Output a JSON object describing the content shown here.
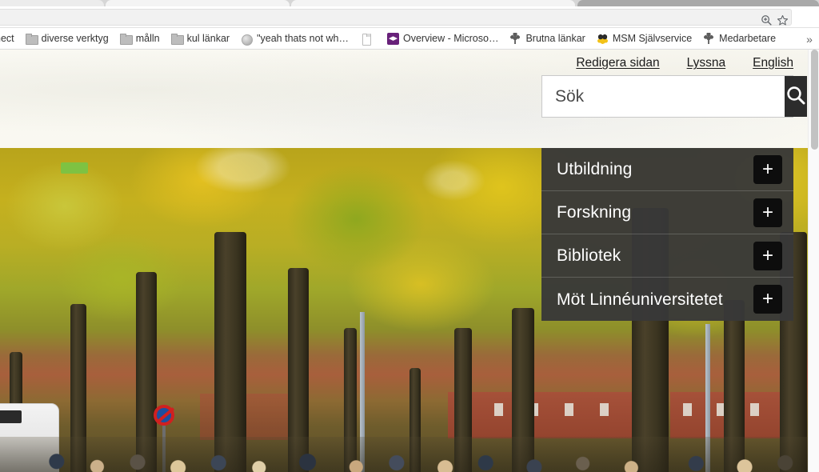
{
  "browser": {
    "toolbar": {
      "zoom_icon": "zoom-in-icon",
      "bookmark_icon": "star-icon",
      "menu_icon": "three-dot-menu-icon"
    },
    "bookmarks": {
      "overflow_label": "»",
      "items": [
        {
          "label": "nect",
          "icon": "partial-bookmark-icon"
        },
        {
          "label": "diverse verktyg",
          "icon": "folder-icon"
        },
        {
          "label": "målln",
          "icon": "folder-icon"
        },
        {
          "label": "kul länkar",
          "icon": "folder-icon"
        },
        {
          "label": "\"yeah thats not wh…",
          "icon": "globe-icon"
        },
        {
          "label": "",
          "icon": "blank-document-icon"
        },
        {
          "label": "Overview - Microso…",
          "icon": "visual-studio-icon"
        },
        {
          "label": "Brutna länkar",
          "icon": "tree-icon"
        },
        {
          "label": "MSM Självservice",
          "icon": "diamond-cluster-icon"
        },
        {
          "label": "Medarbetare",
          "icon": "tree-icon"
        }
      ]
    }
  },
  "page": {
    "top_links": [
      {
        "label": "Redigera sidan"
      },
      {
        "label": "Lyssna"
      },
      {
        "label": "English"
      }
    ],
    "search": {
      "placeholder": "Sök",
      "value": "",
      "button_icon": "search-icon"
    },
    "menu": {
      "items": [
        {
          "label": "Utbildning",
          "expand_icon": "plus-icon",
          "expand_label": "+"
        },
        {
          "label": "Forskning",
          "expand_icon": "plus-icon",
          "expand_label": "+"
        },
        {
          "label": "Bibliotek",
          "expand_icon": "plus-icon",
          "expand_label": "+"
        },
        {
          "label": "Möt Linnéuniversitetet",
          "expand_icon": "plus-icon",
          "expand_label": "+"
        }
      ]
    },
    "hero": {
      "alt": "Autumn tree avenue with yellow leaves, a bus, a no-parking sign and a crowd of people walking"
    }
  },
  "colors": {
    "header_background": "#faf9f3",
    "menu_background": "#383838",
    "menu_plus_background": "#0d0d0d",
    "search_button_background": "#2c2c2c",
    "text_dark": "#1a1a1a"
  }
}
